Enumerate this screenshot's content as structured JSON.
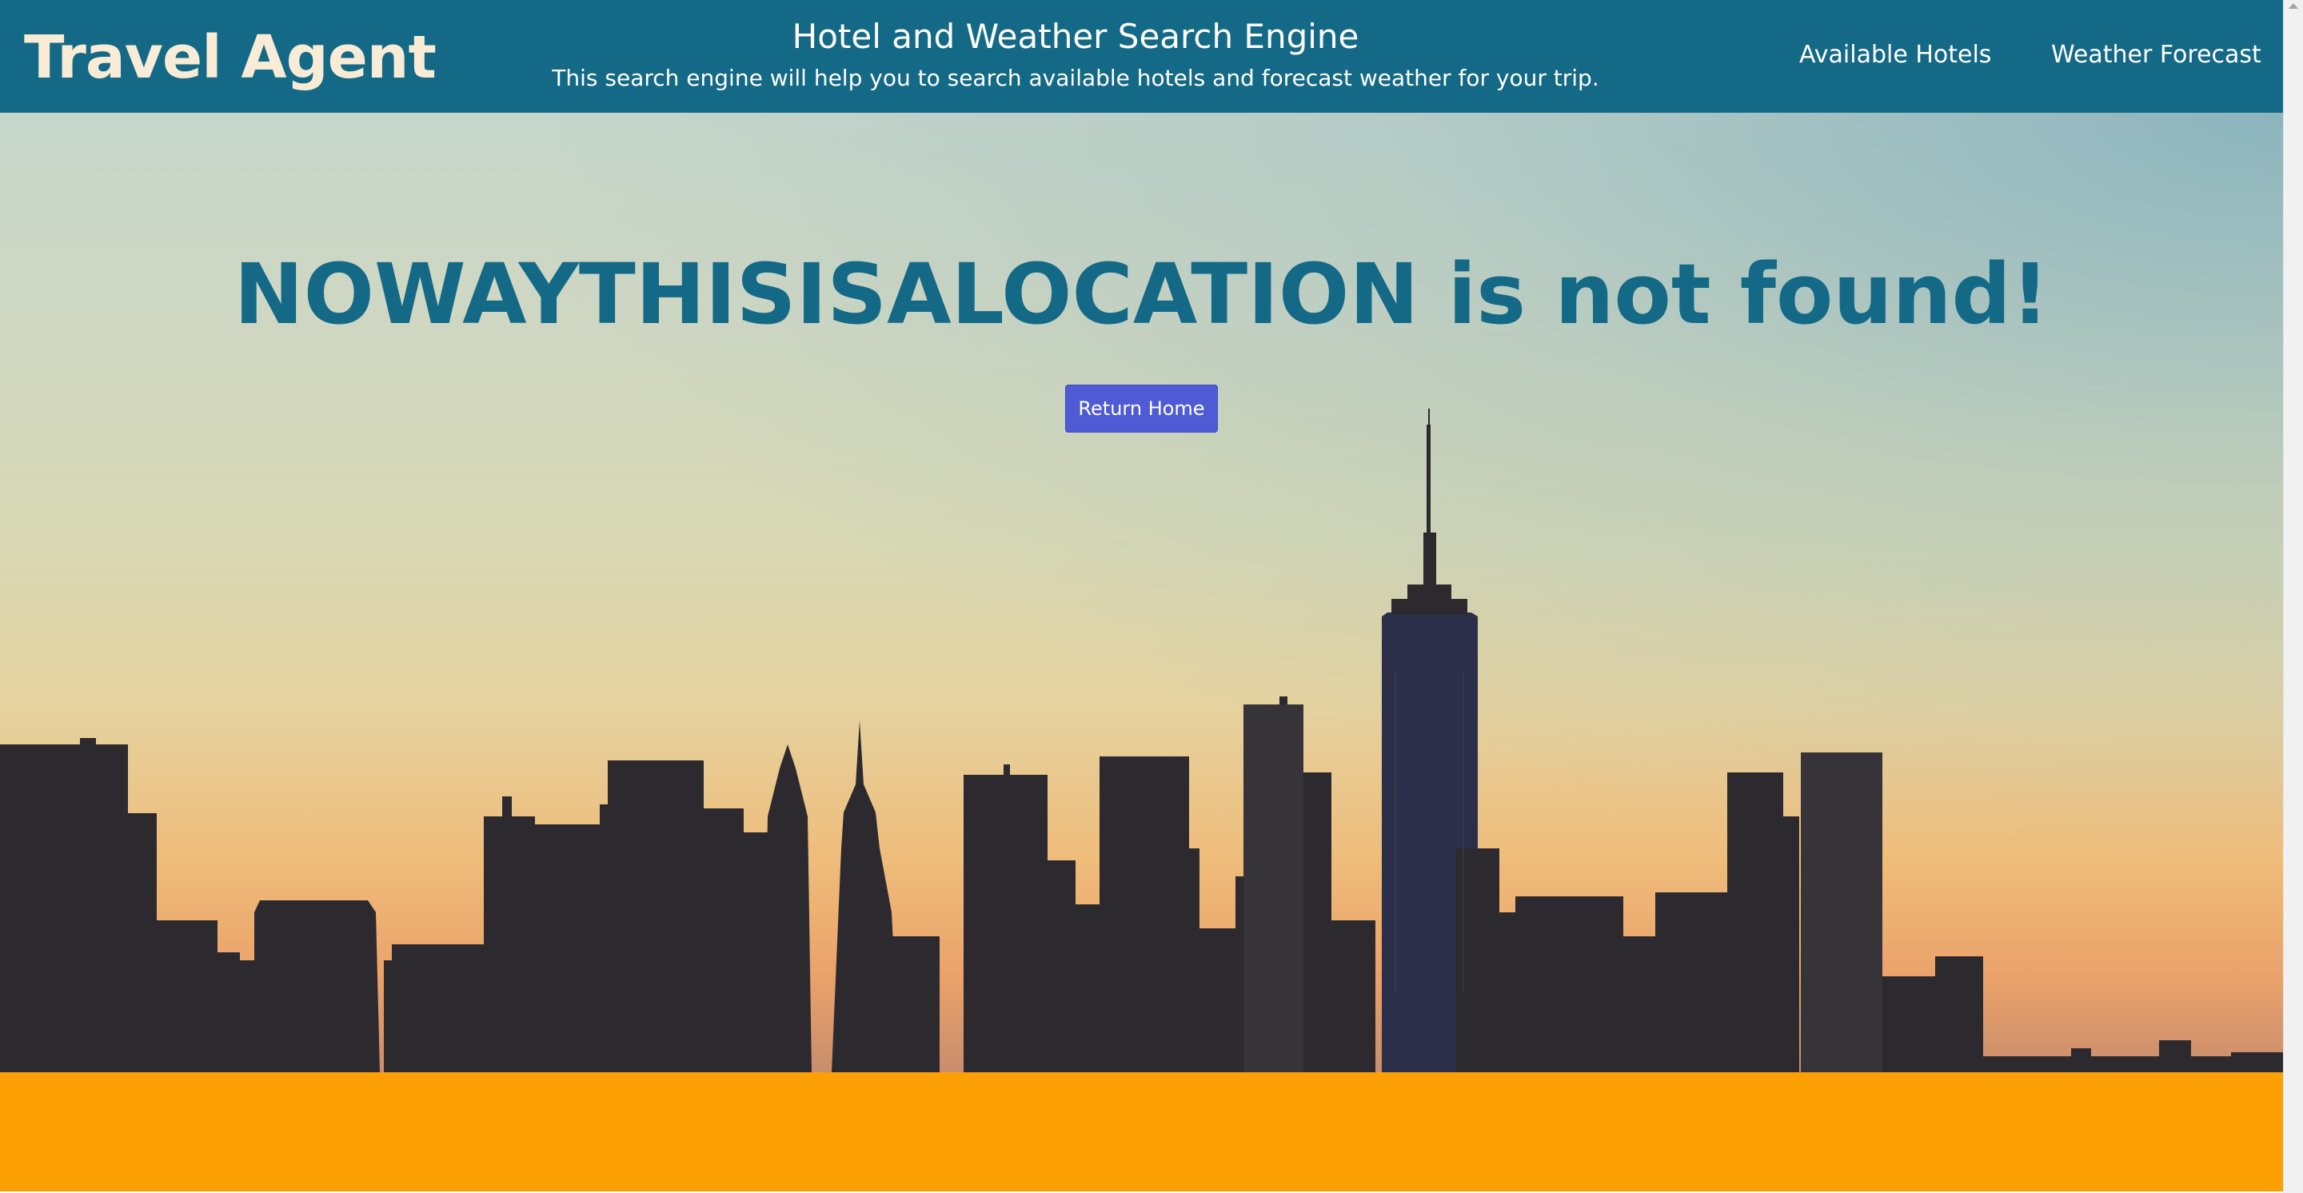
{
  "header": {
    "brand": "Travel Agent",
    "title": "Hotel and Weather Search Engine",
    "subtitle": "This search engine will help you to search available hotels and forecast weather for your trip.",
    "nav": {
      "hotels": "Available Hotels",
      "weather": "Weather Forecast"
    }
  },
  "main": {
    "message": "NOWAYTHISISALOCATION is not found!",
    "return_button": "Return Home",
    "background_image": "city-skyline-sunset"
  },
  "colors": {
    "header": "#146986",
    "brand_text": "#f9ecd6",
    "message_text": "#146986",
    "button": "#4f5bd5",
    "footer": "#fda005",
    "skyline": "#2d2a2f"
  }
}
